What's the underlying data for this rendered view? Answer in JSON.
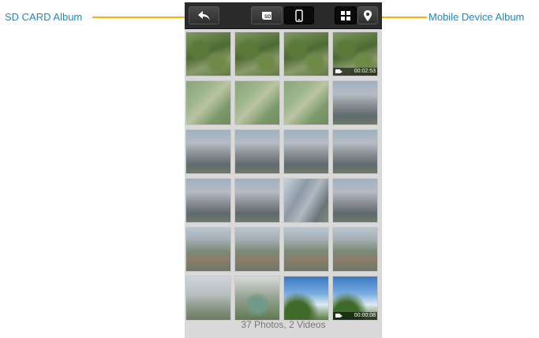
{
  "callouts": {
    "sd_card_album": "SD CARD Album",
    "mobile_device_album": "Mobile Device Album"
  },
  "toolbar": {
    "back_icon": "back-arrow-icon",
    "sd_card_icon": "sd-card-icon",
    "mobile_icon": "mobile-phone-icon",
    "grid_icon": "grid-view-icon",
    "map_icon": "map-pin-icon",
    "active_source": "mobile-device"
  },
  "album": {
    "summary": "37 Photos, 2 Videos",
    "thumbnails": [
      {
        "scene": "aerial-forest",
        "video": false
      },
      {
        "scene": "aerial-forest",
        "video": false
      },
      {
        "scene": "aerial-forest",
        "video": false
      },
      {
        "scene": "aerial-forest",
        "video": true,
        "duration": "00:02:53"
      },
      {
        "scene": "aerial-field",
        "video": false
      },
      {
        "scene": "aerial-field",
        "video": false
      },
      {
        "scene": "aerial-field",
        "video": false
      },
      {
        "scene": "building",
        "video": false
      },
      {
        "scene": "building",
        "video": false
      },
      {
        "scene": "building",
        "video": false
      },
      {
        "scene": "building",
        "video": false
      },
      {
        "scene": "building",
        "video": false
      },
      {
        "scene": "building",
        "video": false
      },
      {
        "scene": "building",
        "video": false
      },
      {
        "scene": "building-tilt",
        "video": false
      },
      {
        "scene": "building",
        "video": false
      },
      {
        "scene": "city",
        "video": false
      },
      {
        "scene": "city",
        "video": false
      },
      {
        "scene": "city",
        "video": false
      },
      {
        "scene": "city",
        "video": false
      },
      {
        "scene": "hazy-town",
        "video": false
      },
      {
        "scene": "park",
        "video": false
      },
      {
        "scene": "sky-plant",
        "video": false
      },
      {
        "scene": "sky-plant",
        "video": true,
        "duration": "00:00:08"
      }
    ]
  },
  "colors": {
    "callout_text": "#1e88c8",
    "leader_line": "#f2b400",
    "toolbar_bg": "#2a2a2a",
    "panel_bg": "#d9d9d9"
  }
}
